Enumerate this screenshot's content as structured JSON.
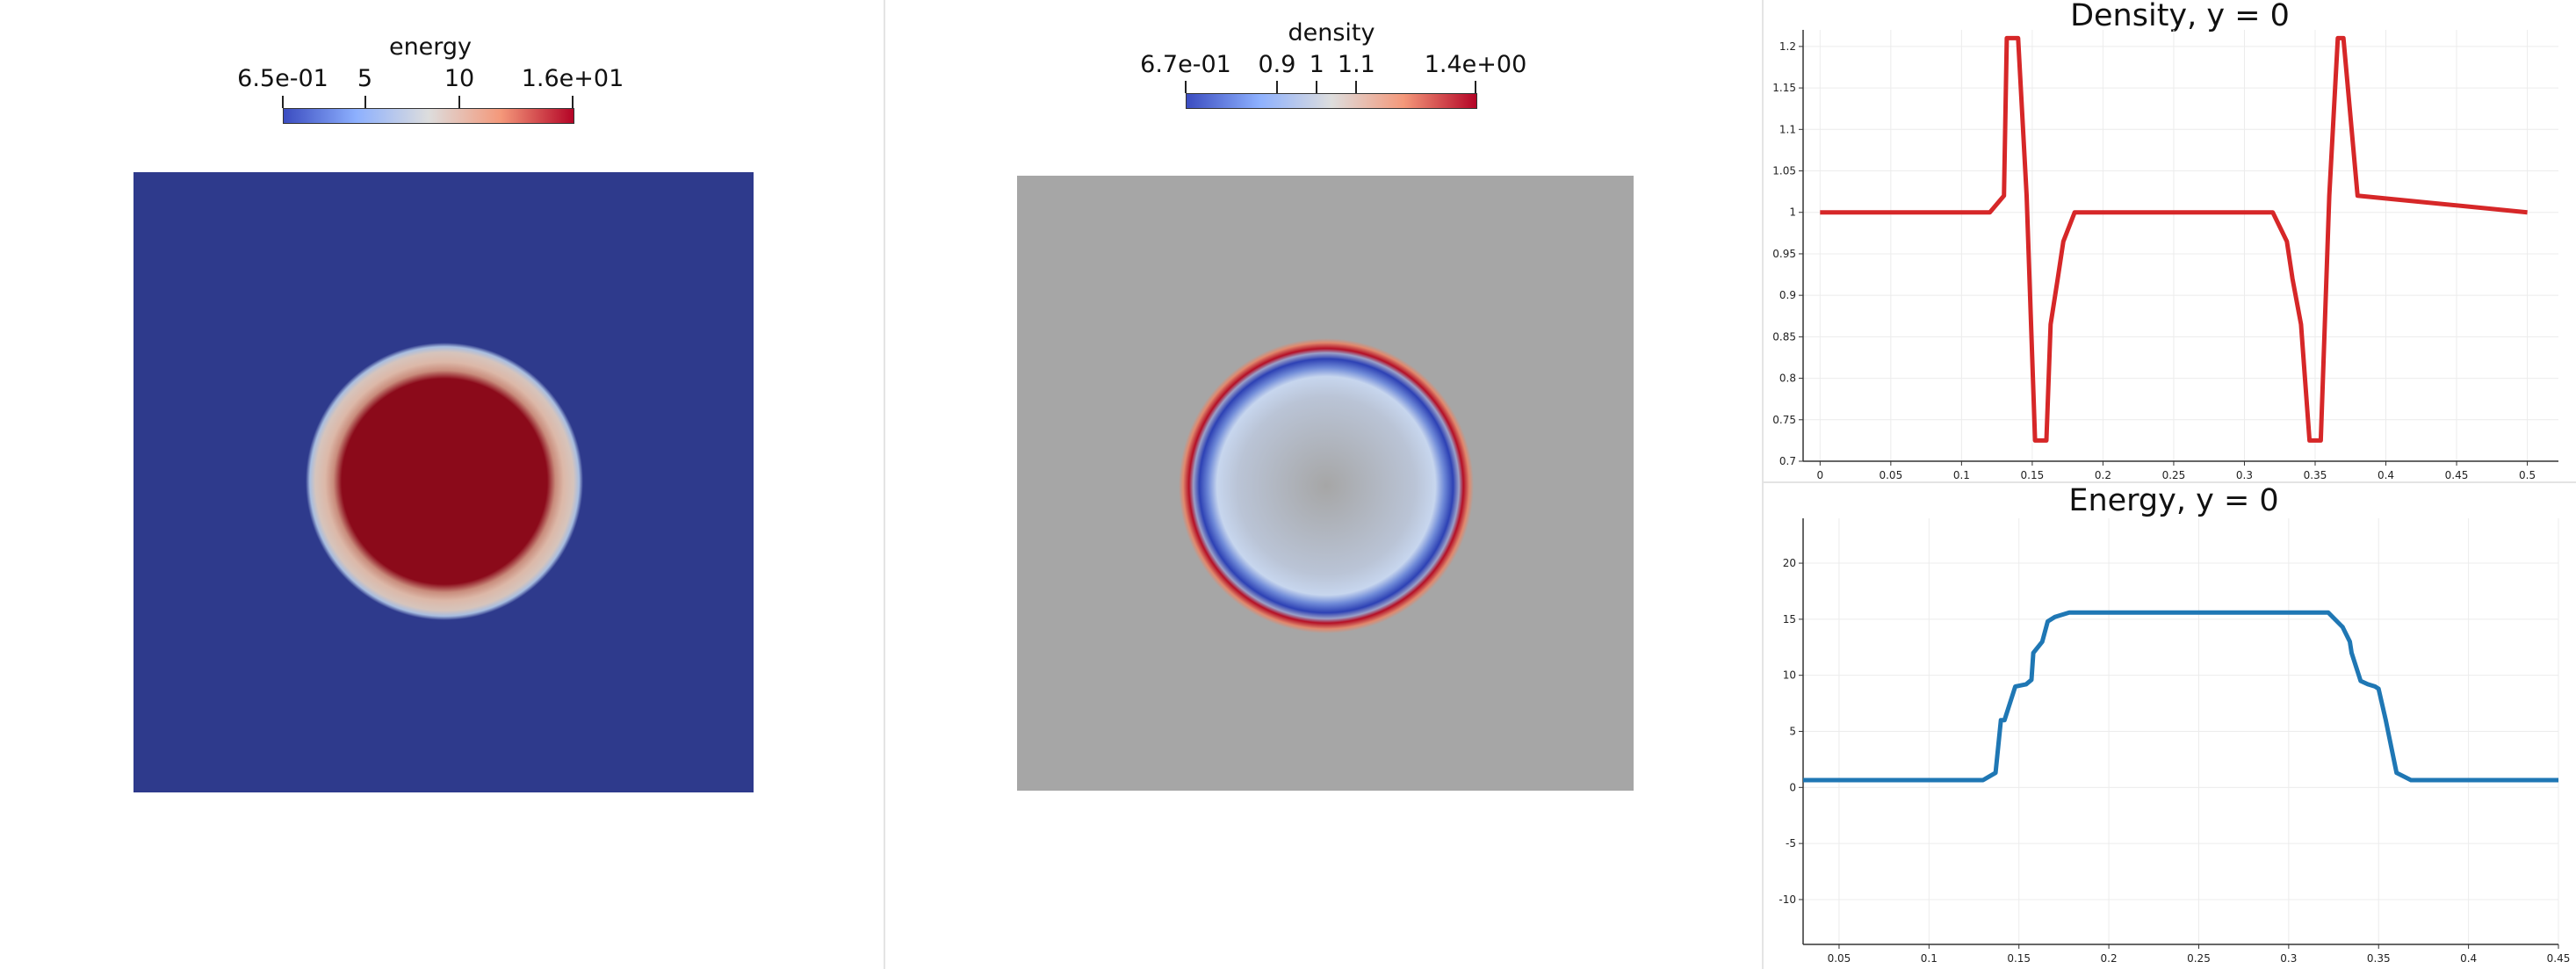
{
  "views": {
    "energy_view": {
      "colorbar": {
        "title": "energy",
        "ticks": [
          "6.5e-01",
          "5",
          "10",
          "1.6e+01"
        ],
        "tick_values": [
          0.65,
          5,
          10,
          16
        ],
        "range": [
          0.65,
          16
        ]
      },
      "colors": {
        "background": "#2e3a8c",
        "inner": "#8b0a1a",
        "ring_light": "#dcb8a8",
        "ring_edge": "#b9c9e6"
      }
    },
    "density_view": {
      "colorbar": {
        "title": "density",
        "ticks": [
          "6.7e-01",
          "0.9",
          "1",
          "1.1",
          "1.4e+00"
        ],
        "tick_values": [
          0.67,
          0.9,
          1.0,
          1.1,
          1.4
        ],
        "range": [
          0.67,
          1.4
        ]
      },
      "colors": {
        "background": "#a6a6a6",
        "high": "#b40f26",
        "low": "#2d41b4",
        "mid_light": "#c7d6ee"
      }
    }
  },
  "chart_data": [
    {
      "type": "line",
      "title": "Density, y = 0",
      "xlabel": "",
      "ylabel": "",
      "xlim": [
        -0.012,
        0.522
      ],
      "ylim": [
        0.7,
        1.22
      ],
      "xticks": [
        "0",
        "0.05",
        "0.1",
        "0.15",
        "0.2",
        "0.25",
        "0.3",
        "0.35",
        "0.4",
        "0.45",
        "0.5"
      ],
      "xtick_values": [
        0,
        0.05,
        0.1,
        0.15,
        0.2,
        0.25,
        0.3,
        0.35,
        0.4,
        0.45,
        0.5
      ],
      "yticks": [
        "0.7",
        "0.75",
        "0.8",
        "0.85",
        "0.9",
        "0.95",
        "1",
        "1.05",
        "1.1",
        "1.15",
        "1.2"
      ],
      "ytick_values": [
        0.7,
        0.75,
        0.8,
        0.85,
        0.9,
        0.95,
        1.0,
        1.05,
        1.1,
        1.15,
        1.2
      ],
      "grid": true,
      "color": "#d62728",
      "x": [
        0,
        0.12,
        0.13,
        0.132,
        0.14,
        0.146,
        0.152,
        0.154,
        0.16,
        0.163,
        0.168,
        0.172,
        0.18,
        0.32,
        0.33,
        0.334,
        0.34,
        0.346,
        0.352,
        0.354,
        0.36,
        0.366,
        0.37,
        0.38,
        0.5
      ],
      "y": [
        1.0,
        1.0,
        1.02,
        1.21,
        1.21,
        1.02,
        0.725,
        0.725,
        0.725,
        0.865,
        0.92,
        0.965,
        1.0,
        1.0,
        0.965,
        0.92,
        0.865,
        0.725,
        0.725,
        0.725,
        1.02,
        1.21,
        1.21,
        1.02,
        1.0
      ]
    },
    {
      "type": "line",
      "title": "Energy, y = 0",
      "xlabel": "",
      "ylabel": "",
      "xlim": [
        0.03,
        0.45
      ],
      "ylim": [
        -14,
        24
      ],
      "xticks": [
        "0.05",
        "0.1",
        "0.15",
        "0.2",
        "0.25",
        "0.3",
        "0.35",
        "0.4",
        "0.45"
      ],
      "xtick_values": [
        0.05,
        0.1,
        0.15,
        0.2,
        0.25,
        0.3,
        0.35,
        0.4,
        0.45
      ],
      "yticks": [
        "-10",
        "-5",
        "0",
        "5",
        "10",
        "15",
        "20"
      ],
      "ytick_values": [
        -10,
        -5,
        0,
        5,
        10,
        15,
        20
      ],
      "grid": true,
      "color": "#1f77b4",
      "x": [
        0.03,
        0.13,
        0.137,
        0.14,
        0.142,
        0.148,
        0.154,
        0.157,
        0.158,
        0.163,
        0.166,
        0.17,
        0.178,
        0.2,
        0.3,
        0.322,
        0.33,
        0.334,
        0.335,
        0.34,
        0.344,
        0.348,
        0.35,
        0.354,
        0.36,
        0.368,
        0.45
      ],
      "y": [
        0.65,
        0.65,
        1.3,
        6.0,
        6.0,
        9.0,
        9.2,
        9.6,
        12.0,
        13.0,
        14.8,
        15.2,
        15.6,
        15.6,
        15.6,
        15.6,
        14.3,
        13.0,
        12.0,
        9.5,
        9.2,
        9.0,
        8.8,
        6.0,
        1.3,
        0.65,
        0.65
      ]
    }
  ]
}
